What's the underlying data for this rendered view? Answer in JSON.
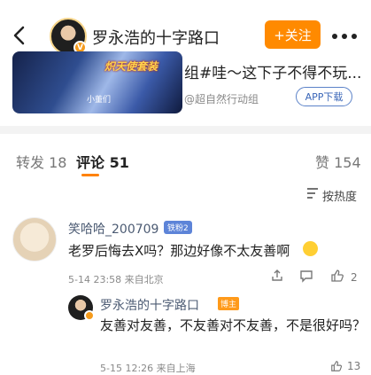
{
  "header": {
    "title": "罗永浩的十字路口",
    "follow_label": "+关注"
  },
  "post": {
    "thumb_title": "炽天使套装",
    "thumb_caption": "小董们",
    "snippet": "组#哇～这下子不得不玩...",
    "topic": "@超自然行动组",
    "app_download_label": "APP下载"
  },
  "tabs": {
    "repost": "转发 18",
    "comment": "评论 51",
    "like": "赞 154",
    "active_color": "#ff8200"
  },
  "sort": {
    "label": "按热度"
  },
  "comments": [
    {
      "user": "笑哈哈_200709",
      "level": "铁粉2",
      "text": "老罗后悔去X吗？那边好像不太友善啊",
      "time": "5-14 23:58 来自北京",
      "likes": "2",
      "replies": [
        {
          "user": "罗永浩的十字路口",
          "tag": "博主",
          "text": "友善对友善，不友善对不友善，不是很好吗？",
          "time": "5-15 12:26 来自上海",
          "likes": "13"
        }
      ]
    }
  ],
  "icons": [
    "back-arrow-icon",
    "more-icon",
    "verified-icon",
    "sort-icon",
    "share-icon",
    "comment-icon",
    "like-icon"
  ]
}
